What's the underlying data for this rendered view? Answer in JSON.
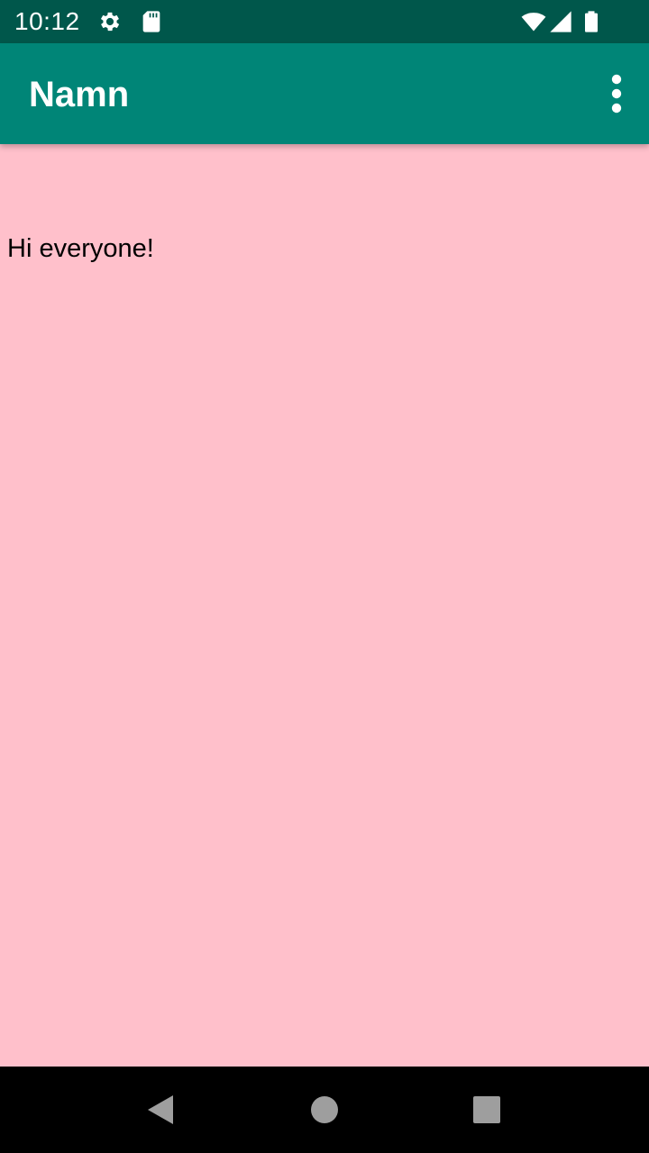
{
  "status_bar": {
    "time": "10:12",
    "icons": [
      "settings-icon",
      "sd-card-icon",
      "wifi-icon",
      "cell-signal-icon",
      "battery-icon"
    ]
  },
  "app_bar": {
    "title": "Namn",
    "overflow_icon": "more-vert-icon"
  },
  "content": {
    "text": "Hi everyone!"
  },
  "nav_bar": {
    "buttons": [
      "back-icon",
      "home-icon",
      "recents-icon"
    ]
  },
  "colors": {
    "status_bar": "#00574b",
    "app_bar": "#008577",
    "background": "#ffc0cb",
    "nav_bar": "#000000"
  }
}
